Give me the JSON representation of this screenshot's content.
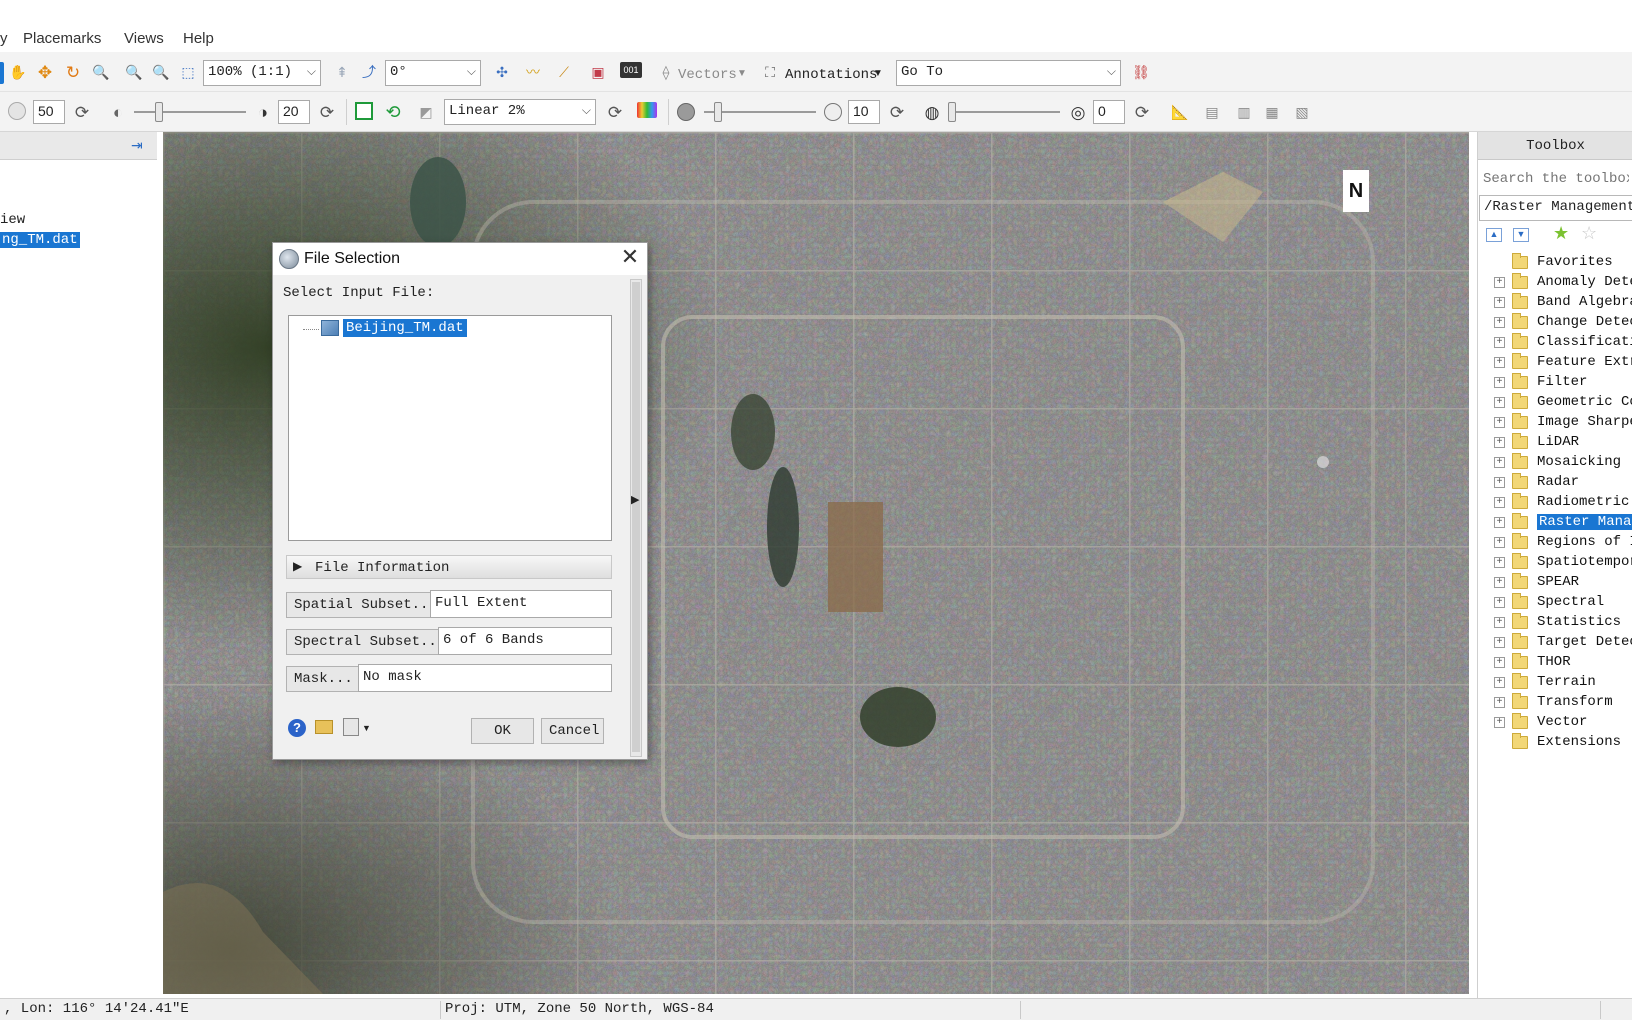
{
  "menu": {
    "items": [
      "y",
      "Placemarks",
      "Views",
      "Help"
    ]
  },
  "toolbar1": {
    "zoom_value": "100% (1:1)",
    "rotation_value": "0°",
    "vectors_label": "Vectors",
    "annotations_label": "Annotations",
    "goto_value": "Go To"
  },
  "toolbar2": {
    "brightness_value": "50",
    "contrast_value": "20",
    "stretch_value": "Linear 2%",
    "sharpen_value": "10",
    "transparency_value": "0",
    "brightness_level": 0.5,
    "contrast_level": 0.2,
    "sharpen_level": 0.1,
    "transparency_level": 0.0
  },
  "layer_manager": {
    "items": [
      {
        "label": "iew",
        "selected": false
      },
      {
        "label": "ng_TM.dat",
        "selected": true
      }
    ]
  },
  "dialog": {
    "title": "File Selection",
    "close": "✕",
    "select_label": "Select Input File:",
    "file_name": "Beijing_TM.dat",
    "file_info_label": "File Information",
    "spatial_subset_button": "Spatial Subset...",
    "spatial_subset_value": "Full Extent",
    "spectral_subset_button": "Spectral Subset...",
    "spectral_subset_value": "6 of 6 Bands",
    "mask_button": "Mask...",
    "mask_value": "No mask",
    "ok_button": "OK",
    "cancel_button": "Cancel"
  },
  "toolbox": {
    "title": "Toolbox",
    "search_placeholder": "Search the toolbox",
    "path": "/Raster Management",
    "items": [
      {
        "label": "Favorites",
        "expandable": false,
        "selected": false
      },
      {
        "label": "Anomaly Detection",
        "expandable": true,
        "selected": false
      },
      {
        "label": "Band Algebra",
        "expandable": true,
        "selected": false
      },
      {
        "label": "Change Detection",
        "expandable": true,
        "selected": false
      },
      {
        "label": "Classification",
        "expandable": true,
        "selected": false
      },
      {
        "label": "Feature Extraction",
        "expandable": true,
        "selected": false
      },
      {
        "label": "Filter",
        "expandable": true,
        "selected": false
      },
      {
        "label": "Geometric Correction",
        "expandable": true,
        "selected": false
      },
      {
        "label": "Image Sharpening",
        "expandable": true,
        "selected": false
      },
      {
        "label": "LiDAR",
        "expandable": true,
        "selected": false
      },
      {
        "label": "Mosaicking",
        "expandable": true,
        "selected": false
      },
      {
        "label": "Radar",
        "expandable": true,
        "selected": false
      },
      {
        "label": "Radiometric Correction",
        "expandable": true,
        "selected": false
      },
      {
        "label": "Raster Management",
        "expandable": true,
        "selected": true
      },
      {
        "label": "Regions of Interest",
        "expandable": true,
        "selected": false
      },
      {
        "label": "Spatiotemporal Analysis",
        "expandable": true,
        "selected": false
      },
      {
        "label": "SPEAR",
        "expandable": true,
        "selected": false
      },
      {
        "label": "Spectral",
        "expandable": true,
        "selected": false
      },
      {
        "label": "Statistics",
        "expandable": true,
        "selected": false
      },
      {
        "label": "Target Detection",
        "expandable": true,
        "selected": false
      },
      {
        "label": "THOR",
        "expandable": true,
        "selected": false
      },
      {
        "label": "Terrain",
        "expandable": true,
        "selected": false
      },
      {
        "label": "Transform",
        "expandable": true,
        "selected": false
      },
      {
        "label": "Vector",
        "expandable": true,
        "selected": false
      },
      {
        "label": "Extensions",
        "expandable": false,
        "selected": false
      }
    ]
  },
  "status": {
    "coords": ", Lon: 116° 14'24.41\"E",
    "projection": "Proj: UTM, Zone 50 North, WGS-84"
  },
  "map": {
    "north_arrow": "N"
  },
  "colors": {
    "selection": "#1a76d2",
    "accent": "#2b6cc4"
  }
}
